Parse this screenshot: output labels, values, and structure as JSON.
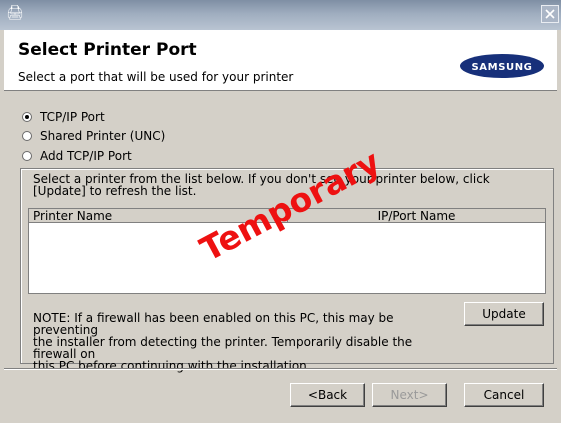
{
  "titlebar": {
    "close_glyph": "✕",
    "app_icon": "installer-icon"
  },
  "header": {
    "title": "Select Printer Port",
    "subtitle": "Select a port that will be used for your printer",
    "logo_text": "SAMSUNG"
  },
  "port_options": [
    {
      "label": "TCP/IP Port",
      "checked": true
    },
    {
      "label": "Shared Printer (UNC)",
      "checked": false
    },
    {
      "label": "Add TCP/IP Port",
      "checked": false
    }
  ],
  "instructions": {
    "line1": "Select a printer from the list below. If you don't see your printer below, click",
    "line2": "[Update] to refresh the list."
  },
  "table": {
    "columns": [
      "Printer Name",
      "IP/Port Name"
    ],
    "rows": []
  },
  "note": {
    "line1": "NOTE: If a firewall has been enabled on this PC, this may be preventing",
    "line2": "the installer from detecting the printer. Temporarily disable the firewall on",
    "line3": "this PC before continuing with the installation."
  },
  "buttons": {
    "update": "Update",
    "back": "<Back",
    "next": "Next>",
    "cancel": "Cancel"
  },
  "watermark": "Temporary",
  "colors": {
    "watermark": "#ee1111",
    "dialog_bg": "#d4d0c8"
  }
}
